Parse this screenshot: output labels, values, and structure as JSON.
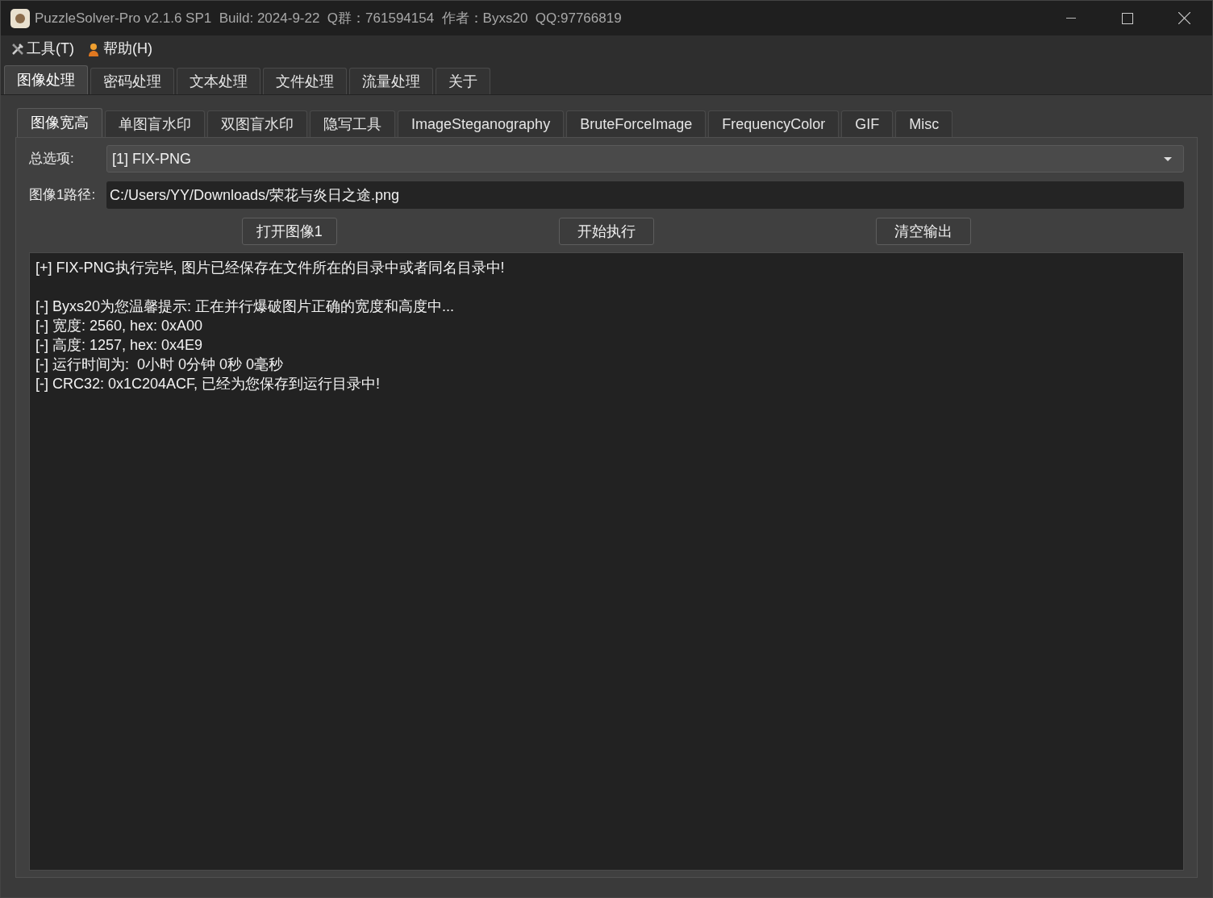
{
  "window": {
    "title": "PuzzleSolver-Pro v2.1.6 SP1  Build: 2024-9-22  Q群：761594154  作者：Byxs20  QQ:97766819"
  },
  "menu": [
    {
      "label": "工具(T)",
      "kind": "tools"
    },
    {
      "label": "帮助(H)",
      "kind": "help"
    }
  ],
  "main_tabs": [
    {
      "label": "图像处理",
      "selected": true
    },
    {
      "label": "密码处理",
      "selected": false
    },
    {
      "label": "文本处理",
      "selected": false
    },
    {
      "label": "文件处理",
      "selected": false
    },
    {
      "label": "流量处理",
      "selected": false
    },
    {
      "label": "关于",
      "selected": false
    }
  ],
  "sub_tabs": [
    {
      "label": "图像宽高",
      "selected": true
    },
    {
      "label": "单图盲水印",
      "selected": false
    },
    {
      "label": "双图盲水印",
      "selected": false
    },
    {
      "label": "隐写工具",
      "selected": false
    },
    {
      "label": "ImageSteganography",
      "selected": false
    },
    {
      "label": "BruteForceImage",
      "selected": false
    },
    {
      "label": "FrequencyColor",
      "selected": false
    },
    {
      "label": "GIF",
      "selected": false
    },
    {
      "label": "Misc",
      "selected": false
    }
  ],
  "option": {
    "label": "总选项:",
    "value": "[1] FIX-PNG"
  },
  "path": {
    "label": "图像1路径:",
    "value": "C:/Users/YY/Downloads/荣花与炎日之途.png"
  },
  "buttons": [
    "打开图像1",
    "开始执行",
    "清空输出"
  ],
  "output": {
    "paragraphs": [
      [
        "[+] FIX-PNG执行完毕, 图片已经保存在文件所在的目录中或者同名目录中!"
      ],
      [
        "[-] Byxs20为您温馨提示: 正在并行爆破图片正确的宽度和高度中...",
        "[-] 宽度: 2560, hex: 0xA00",
        "[-] 高度: 1257, hex: 0x4E9",
        "[-] 运行时间为:  0小时 0分钟 0秒 0毫秒",
        "[-] CRC32: 0x1C204ACF, 已经为您保存到运行目录中!"
      ]
    ]
  }
}
